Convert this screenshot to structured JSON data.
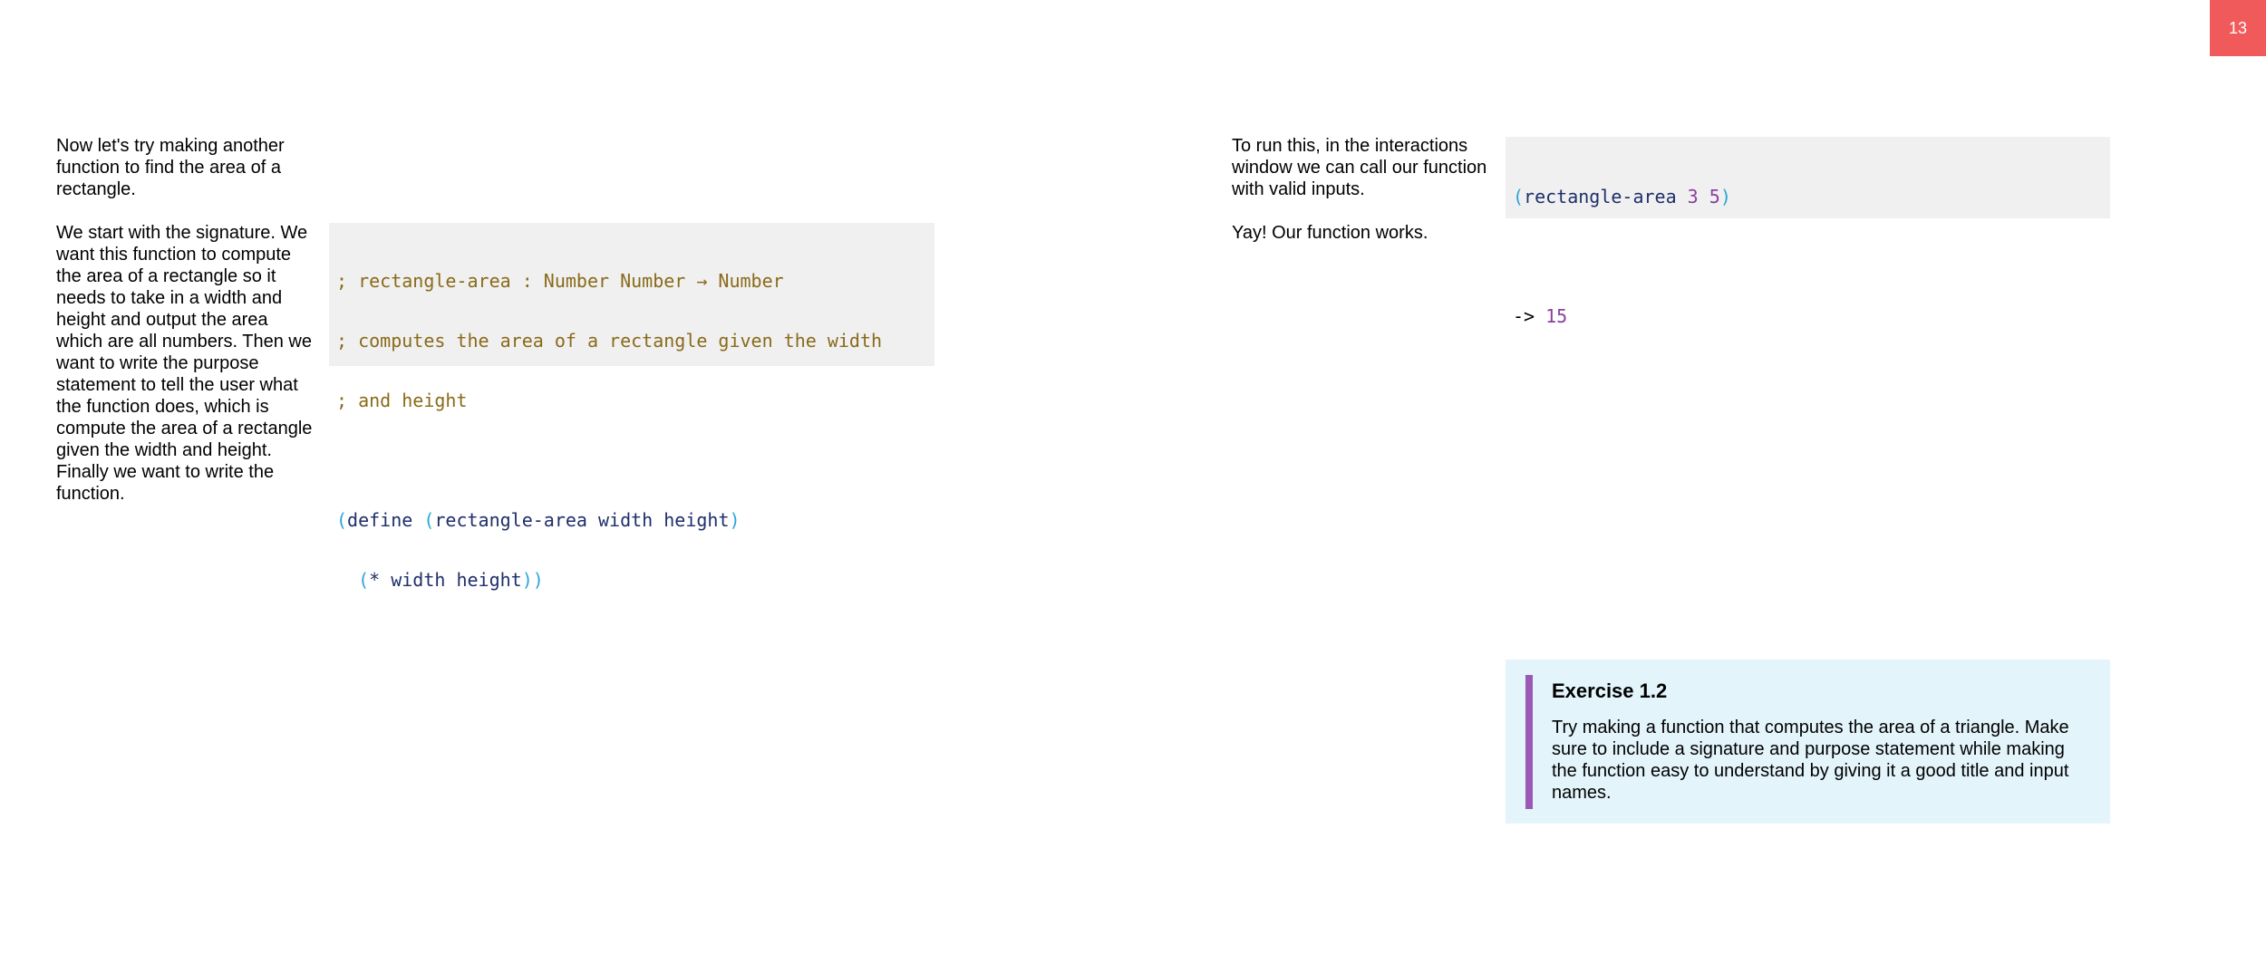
{
  "page_number": "13",
  "left_column": {
    "paragraph_1": "Now let's try making another function to find the area of a rectangle.",
    "paragraph_2": "We start with the signature. We want this function to compute the area of a rectangle so it needs to take in a width and height and output the area which are all numbers. Then we want to write the purpose statement to tell the user what the function does, which is compute the area of a rectangle given the width and height. Finally we want to write the function."
  },
  "code_definition": {
    "comment_1": "; rectangle-area : Number Number → Number",
    "comment_2": "; computes the area of a rectangle given the width",
    "comment_3": "; and height",
    "define_open_paren": "(",
    "define_keyword": "define ",
    "signature_open_paren": "(",
    "signature_text": "rectangle-area width height",
    "signature_close_paren": ")",
    "body_indent": "  ",
    "body_open_paren": "(",
    "body_text": "* width height",
    "body_close_parens": "))"
  },
  "right_column": {
    "paragraph_1": "To run this, in the interactions window we can call our function with valid inputs.",
    "paragraph_2": "Yay! Our function works."
  },
  "code_interaction": {
    "open_paren": "(",
    "call_name": "rectangle-area ",
    "arg_1": "3",
    "space": " ",
    "arg_2": "5",
    "close_paren": ")",
    "result_arrow": "-> ",
    "result_value": "15"
  },
  "exercise": {
    "title": "Exercise 1.2",
    "body": "Try making a function that computes the area of a triangle. Make sure to include a signature and purpose statement while making the function easy to understand by giving it a good title and input names."
  },
  "colors": {
    "badge": "#f05a5b",
    "code_background": "#f0f0f0",
    "comment": "#8a6a1a",
    "paren": "#2aa5d8",
    "identifier": "#1f2f6b",
    "number": "#8b3fa0",
    "exercise_background": "#e3f4fb",
    "exercise_bar": "#9b59b6"
  }
}
